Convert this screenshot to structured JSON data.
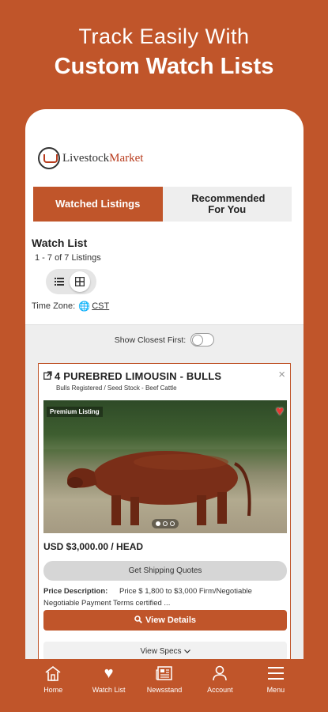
{
  "promo": {
    "line1": "Track Easily With",
    "line2": "Custom Watch Lists"
  },
  "logo": {
    "text_a": "Livestock",
    "text_b": "Market"
  },
  "tabs": [
    {
      "label": "Watched Listings",
      "active": true
    },
    {
      "label": "Recommended For You",
      "active": false
    }
  ],
  "watchlist": {
    "title": "Watch List",
    "count": "1 - 7 of 7 Listings",
    "timezone_label": "Time Zone:",
    "timezone_value": "CST"
  },
  "filter": {
    "closest_label": "Show Closest First:"
  },
  "listing": {
    "title": "4 PUREBRED LIMOUSIN - BULLS",
    "subtitle": "Bulls Registered / Seed Stock - Beef Cattle",
    "badge": "Premium Listing",
    "price": "USD $3,000.00 / HEAD",
    "shipping_button": "Get Shipping Quotes",
    "price_desc_label": "Price Description:",
    "price_desc_value": "Price $ 1,800 to $3,000 Firm/Negotiable",
    "payment_text": "Negotiable Payment Terms certified ...",
    "details_button": "View Details",
    "specs_button": "View Specs",
    "close_glyph": "×"
  },
  "nav": [
    {
      "label": "Home",
      "icon": "home-icon"
    },
    {
      "label": "Watch List",
      "icon": "heart-icon"
    },
    {
      "label": "Newsstand",
      "icon": "newspaper-icon"
    },
    {
      "label": "Account",
      "icon": "person-icon"
    },
    {
      "label": "Menu",
      "icon": "menu-icon"
    }
  ],
  "colors": {
    "brand": "#c0552a",
    "heart": "#e53935"
  }
}
